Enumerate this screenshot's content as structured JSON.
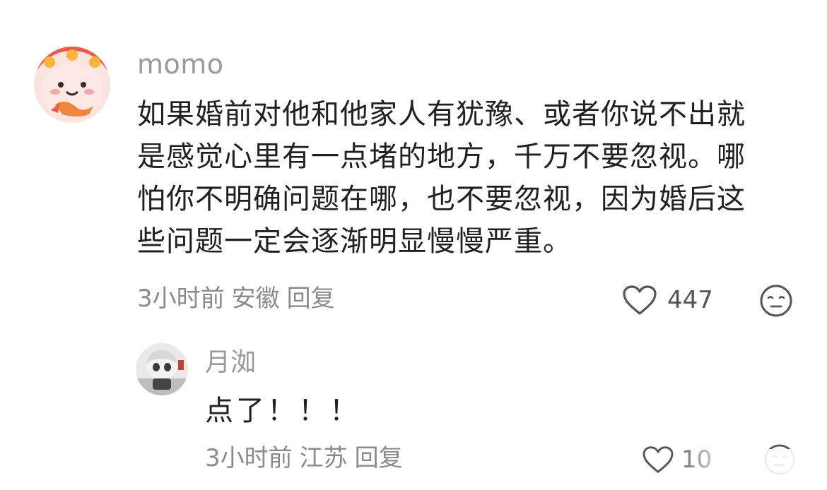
{
  "main_comment": {
    "username": "momo",
    "text_lines": [
      "如果婚前对他和他家人有犹豫、或者你说不出就",
      "是感觉心里有一点堵的地方，千万不要忽视。哪",
      "怕你不明确问题在哪，也不要忽视，因为婚后这",
      "些问题一定会逐渐明显慢慢严重。"
    ],
    "time": "3小时前",
    "location": "安徽",
    "reply_label": "回复",
    "like_count": "447",
    "icons": {
      "like": "heart-outline-icon",
      "dislike": "neutral-face-icon"
    }
  },
  "reply_comment": {
    "username": "月洳",
    "text": "点了！！！",
    "time": "3小时前",
    "location": "江苏",
    "reply_label": "回复",
    "like_count": "10",
    "icons": {
      "like": "heart-outline-icon",
      "dislike": "neutral-face-icon"
    }
  },
  "colors": {
    "username": "#9a9a9a",
    "body_text": "#202020",
    "meta_text": "#8a8a8a",
    "icon_stroke": "#555555"
  }
}
